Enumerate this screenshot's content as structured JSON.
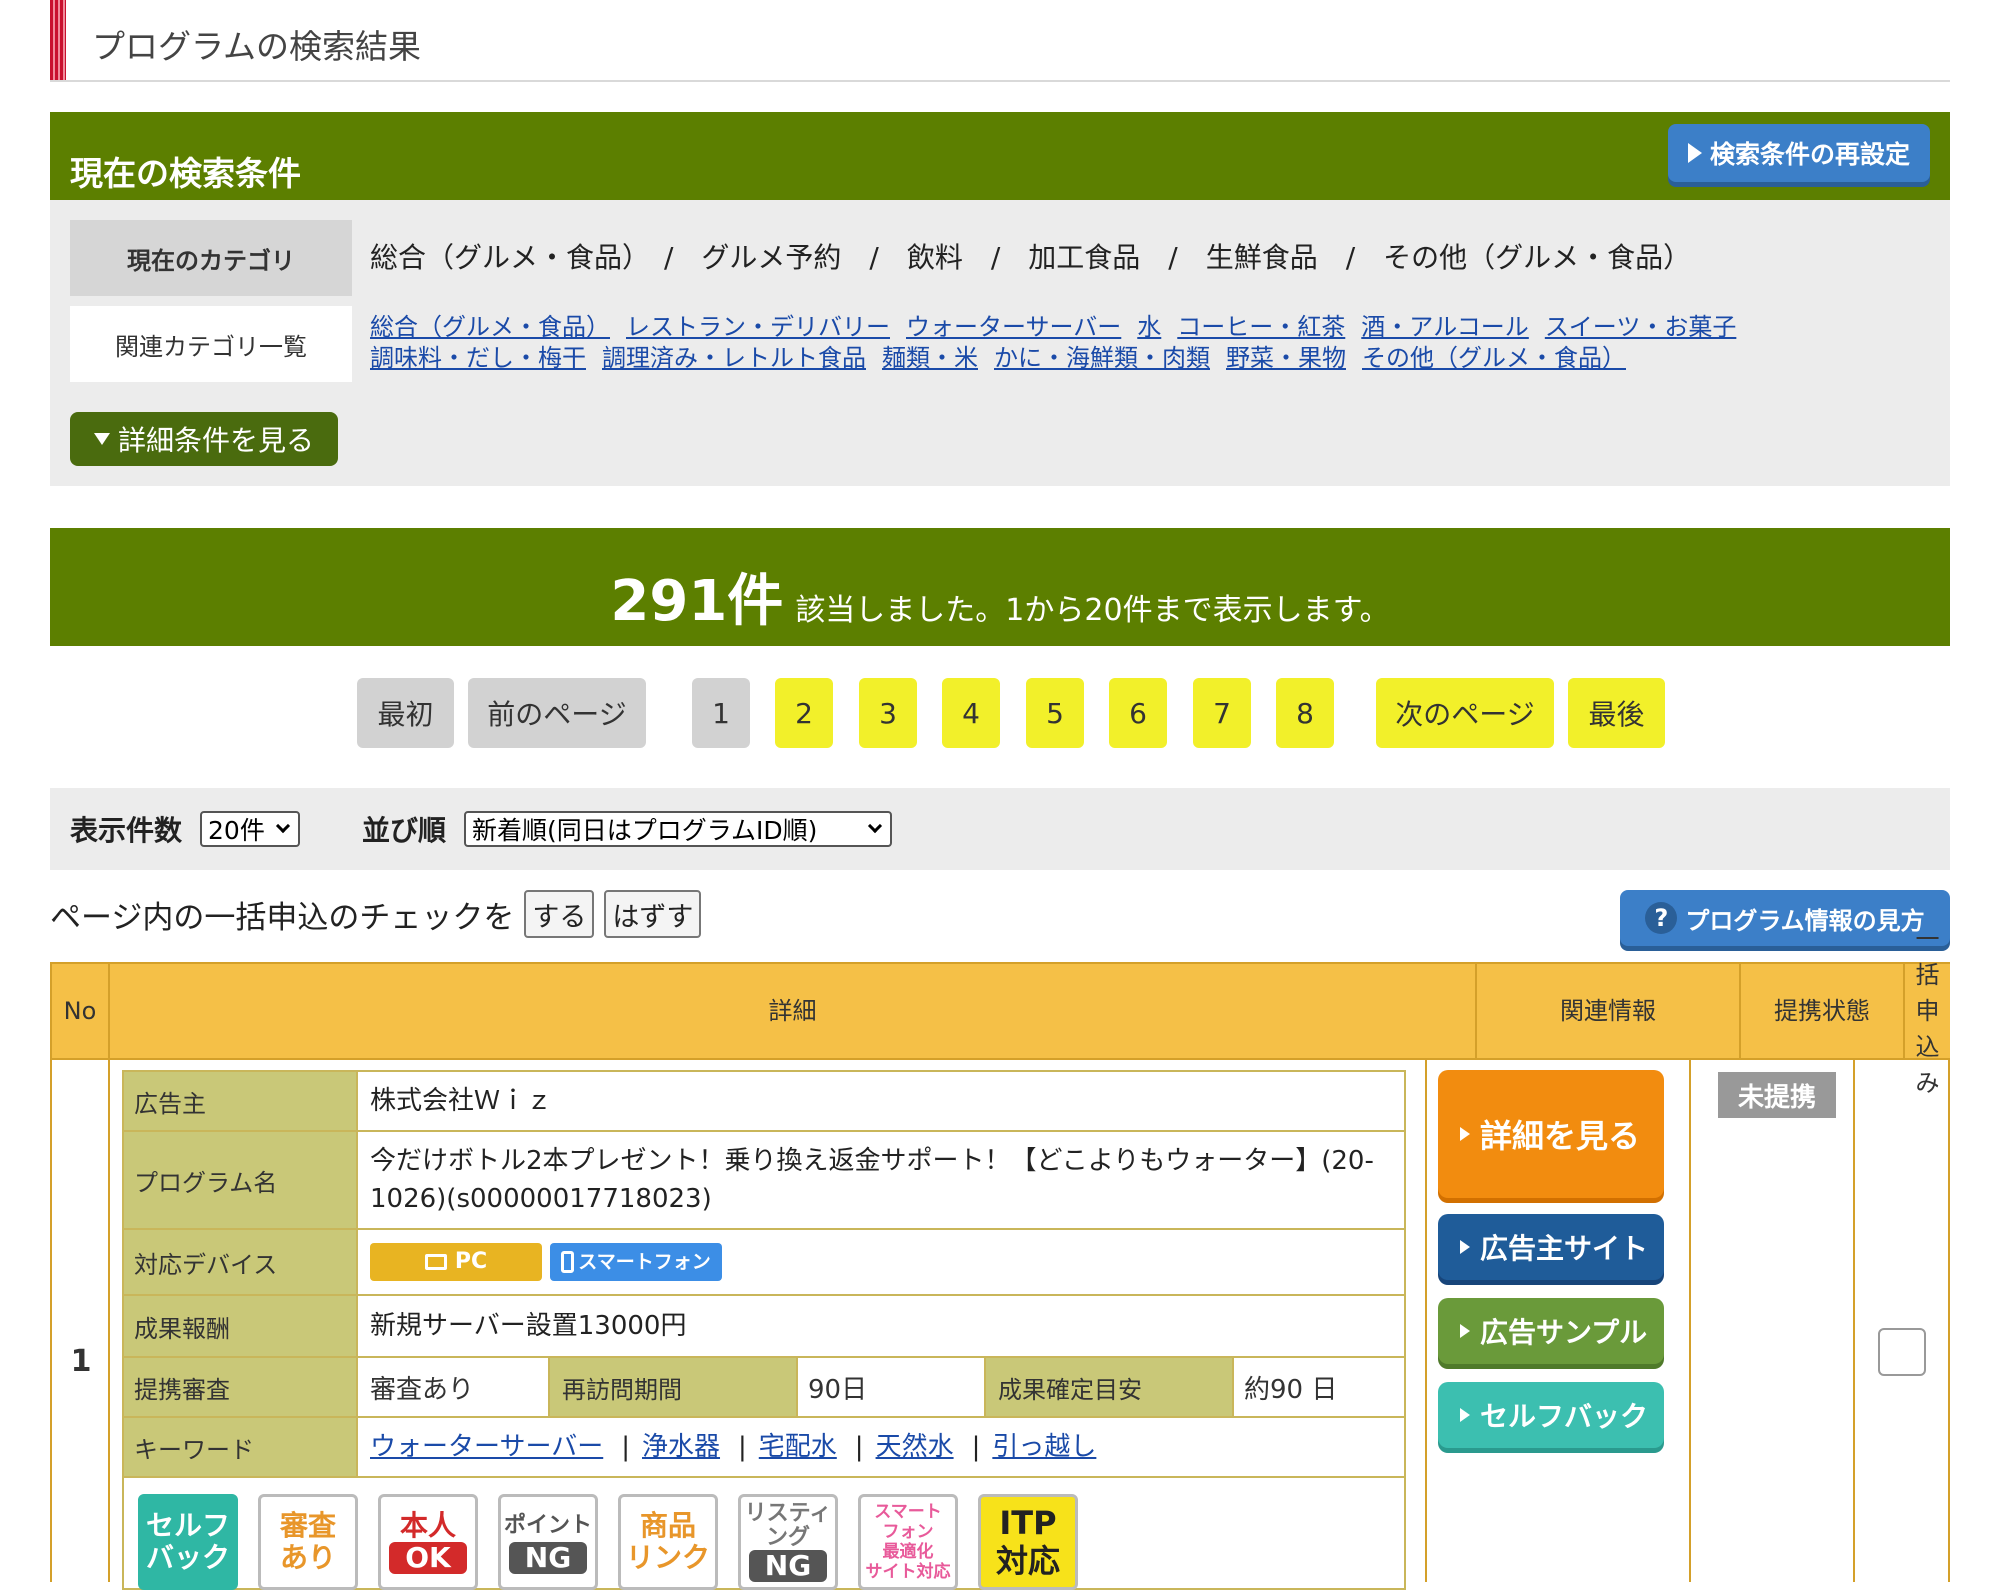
{
  "page_title": "プログラムの検索結果",
  "conditions": {
    "title": "現在の検索条件",
    "reset_label": "検索条件の再設定",
    "current_category_label": "現在のカテゴリ",
    "current_categories": "総合（グルメ・食品）　/　グルメ予約　/　飲料　/　加工食品　/　生鮮食品　/　その他（グルメ・食品）",
    "related_label": "関連カテゴリ一覧",
    "related": [
      "総合（グルメ・食品）",
      "レストラン・デリバリー",
      "ウォーターサーバー",
      "水",
      "コーヒー・紅茶",
      "酒・アルコール",
      "スイーツ・お菓子",
      "調味料・だし・梅干",
      "調理済み・レトルト食品",
      "麺類・米",
      "かに・海鮮類・肉類",
      "野菜・果物",
      "その他（グルメ・食品）"
    ],
    "detail_label": "詳細条件を見る"
  },
  "result": {
    "count": "291件",
    "text": "該当しました。1から20件まで表示します。"
  },
  "pagination": {
    "first": "最初",
    "prev": "前のページ",
    "pages": [
      "1",
      "2",
      "3",
      "4",
      "5",
      "6",
      "7",
      "8"
    ],
    "current": "1",
    "next": "次のページ",
    "last": "最後"
  },
  "options": {
    "per_page_label": "表示件数",
    "per_page_value": "20件",
    "sort_label": "並び順",
    "sort_value": "新着順(同日はプログラムID順)"
  },
  "bulk": {
    "text": "ページ内の一括申込のチェックを",
    "check_label": "する",
    "uncheck_label": "はずす"
  },
  "help_label": "プログラム情報の見方",
  "table": {
    "headers": {
      "no": "No",
      "detail": "詳細",
      "related": "関連情報",
      "status": "提携状態",
      "bulk": "一括申込み"
    },
    "row": {
      "no": "1",
      "advertiser_label": "広告主",
      "advertiser": "株式会社Ｗｉｚ",
      "program_label": "プログラム名",
      "program": "今だけボトル2本プレゼント！乗り換え返金サポート！【どこよりもウォーター】(20-1026)(s00000017718023)",
      "device_label": "対応デバイス",
      "device_pc": "PC",
      "device_sp": "スマートフォン",
      "reward_label": "成果報酬",
      "reward": "新規サーバー設置13000円",
      "review_label": "提携審査",
      "review": "審査あり",
      "revisit_label": "再訪問期間",
      "revisit": "90日",
      "confirm_label": "成果確定目安",
      "confirm": "約90 日",
      "keyword_label": "キーワード",
      "keywords": [
        "ウォーターサーバー",
        "浄水器",
        "宅配水",
        "天然水",
        "引っ越し"
      ],
      "badges": {
        "selfback": "セルフ\nバック",
        "review": "審査\nあり",
        "honnin": "本人",
        "honnin_ok": "OK",
        "point": "ポイント",
        "point_ng": "NG",
        "shohin": "商品\nリンク",
        "listing": "リスティ\nング",
        "listing_ng": "NG",
        "smartphone": "スマート\nフォン\n最適化\nサイト対応",
        "itp": "ITP\n対応"
      },
      "buttons": {
        "detail": "詳細を見る",
        "site": "広告主サイト",
        "sample": "広告サンプル",
        "selfback": "セルフバック"
      },
      "status": "未提携"
    }
  },
  "colors": {
    "green": "#5c7f00",
    "blue": "#3c7fc8",
    "yellow": "#f2f02a",
    "table_header": "#f5c047",
    "orange": "#f28c0f"
  }
}
